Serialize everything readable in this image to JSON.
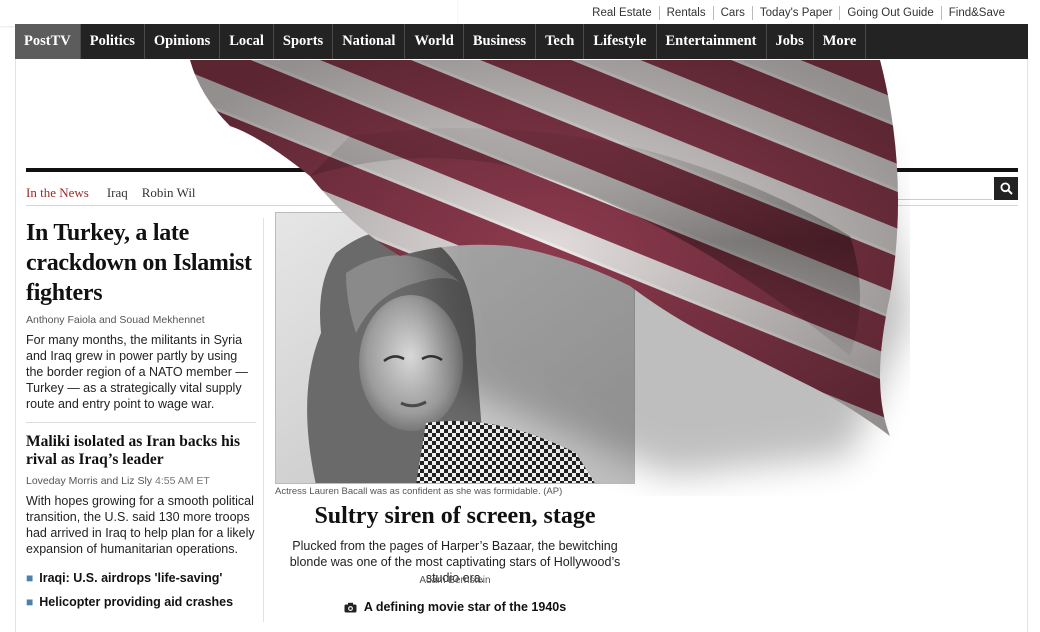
{
  "utility_links": [
    "Real Estate",
    "Rentals",
    "Cars",
    "Today's Paper",
    "Going Out Guide",
    "Find&Save"
  ],
  "nav": [
    "PostTV",
    "Politics",
    "Opinions",
    "Local",
    "Sports",
    "National",
    "World",
    "Business",
    "Tech",
    "Lifestyle",
    "Entertainment",
    "Jobs",
    "More"
  ],
  "in_the_news": {
    "label": "In the News",
    "topics": [
      "Iraq",
      "Robin Wil"
    ]
  },
  "lead_story": {
    "headline": "In Turkey, a late crackdown on Islamist fighters",
    "byline": "Anthony Faiola and Souad Mekhennet",
    "blurb": "For many months, the militants in Syria and Iraq grew in power partly by using the border region of a NATO member — Turkey — as a strategically vital supply route and entry point to wage war."
  },
  "second_story": {
    "headline": "Maliki isolated as Iran backs his rival as Iraq’s leader",
    "byline": "Loveday Morris and Liz Sly",
    "time": "4:55 AM ET",
    "blurb": "With hopes growing for a smooth political transition, the U.S. said 130 more troops had arrived in Iraq to help plan for a likely expansion of humanitarian operations."
  },
  "bullets": [
    "Iraqi: U.S. airdrops 'life-saving'",
    "Helicopter providing aid crashes"
  ],
  "feature": {
    "caption": "Actress Lauren Bacall was as confident as she was formidable. (AP)",
    "headline": "Sultry siren of screen, stage",
    "blurb": "Plucked from the pages of Harper’s Bazaar, the bewitching blonde was one of the most captivating stars of Hollywood’s studio era.",
    "byline": "Adam Bernstein",
    "gallery_link": "A defining movie star of the 1940s"
  },
  "icons": {
    "search": "search-icon",
    "camera": "camera-icon"
  },
  "colors": {
    "nav_bg": "#232323",
    "news_label": "#9a2a2a",
    "flag_red": "#8c3a4d"
  }
}
